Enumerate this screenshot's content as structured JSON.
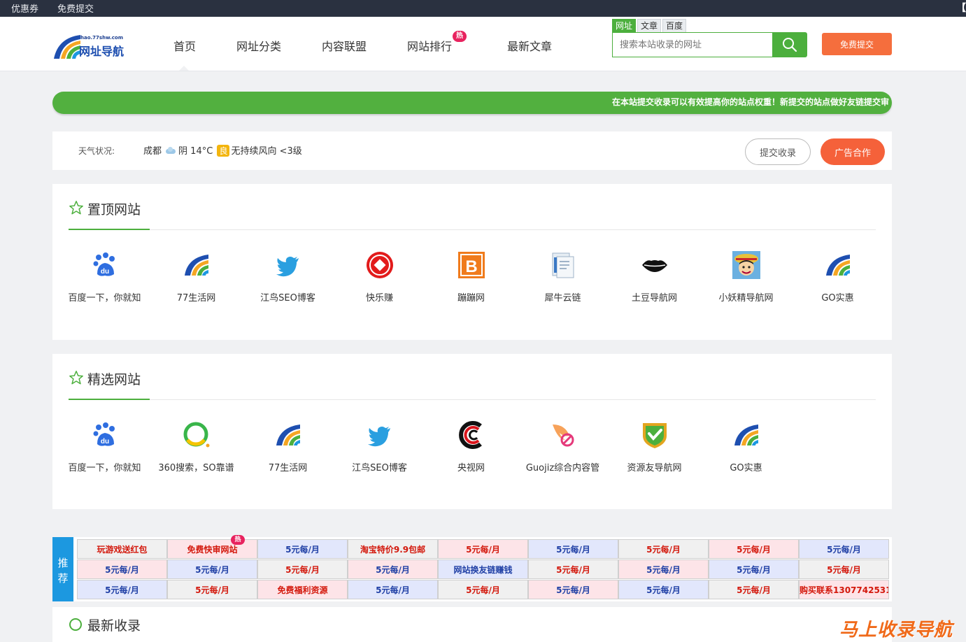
{
  "topbar": {
    "link1": "优惠券",
    "link2": "免费提交",
    "right_text": "【"
  },
  "logo": {
    "url": "hao.77shw.com",
    "name": "网址导航"
  },
  "nav": {
    "items": [
      "首页",
      "网址分类",
      "内容联盟",
      "网站排行",
      "最新文章"
    ],
    "active": "首页",
    "hot_badge": "热"
  },
  "search": {
    "tabs": [
      "网址",
      "文章",
      "百度"
    ],
    "active_tab": "网址",
    "placeholder": "搜索本站收录的网址",
    "submit_label": "免费提交"
  },
  "notice": {
    "text": "在本站提交收录可以有效提高你的站点权重！新提交的站点做好友链提交审"
  },
  "weather": {
    "label": "天气状况:",
    "city": "成都",
    "condition": "阴",
    "temp": "14°C",
    "aqi": "良",
    "wind": "无持续风向 <3级",
    "btn_submit": "提交收录",
    "btn_ad": "广告合作"
  },
  "pinned": {
    "title": "置顶网站",
    "sites": [
      {
        "name": "百度一下，你就知",
        "icon": "baidu-icon"
      },
      {
        "name": "77生活网",
        "icon": "77shw-logo-icon"
      },
      {
        "name": "江鸟SEO博客",
        "icon": "twitter-bird-icon"
      },
      {
        "name": "快乐赚",
        "icon": "red-coin-icon"
      },
      {
        "name": "蹦蹦网",
        "icon": "orange-b-icon"
      },
      {
        "name": "犀牛云链",
        "icon": "document-icon"
      },
      {
        "name": "土豆导航网",
        "icon": "lips-icon"
      },
      {
        "name": "小妖精导航网",
        "icon": "anime-avatar-icon"
      },
      {
        "name": "GO实惠",
        "icon": "77shw-logo-icon"
      }
    ]
  },
  "featured": {
    "title": "精选网站",
    "sites": [
      {
        "name": "百度一下，你就知",
        "icon": "baidu-icon"
      },
      {
        "name": "360搜索，SO靠谱",
        "icon": "360-ring-icon"
      },
      {
        "name": "77生活网",
        "icon": "77shw-logo-icon"
      },
      {
        "name": "江鸟SEO博客",
        "icon": "twitter-bird-icon"
      },
      {
        "name": "央视网",
        "icon": "cctv-icon"
      },
      {
        "name": "Guojiz综合内容管",
        "icon": "feather-icon"
      },
      {
        "name": "资源友导航网",
        "icon": "shield-check-icon"
      },
      {
        "name": "GO实惠",
        "icon": "77shw-logo-icon"
      }
    ]
  },
  "ads": {
    "side_label": [
      "推",
      "荐"
    ],
    "rows": [
      [
        {
          "text": "玩游戏送红包",
          "color": "red",
          "bg": "gray"
        },
        {
          "text": "免费快审网站",
          "color": "red",
          "bg": "pink"
        },
        {
          "text": "5元每/月",
          "color": "blue",
          "bg": "blue"
        },
        {
          "text": "淘宝特价9.9包邮",
          "color": "red",
          "bg": "gray"
        },
        {
          "text": "5元每/月",
          "color": "red",
          "bg": "pink"
        },
        {
          "text": "5元每/月",
          "color": "blue",
          "bg": "blue"
        },
        {
          "text": "5元每/月",
          "color": "red",
          "bg": "gray"
        },
        {
          "text": "5元每/月",
          "color": "red",
          "bg": "pink"
        },
        {
          "text": "5元每/月",
          "color": "blue",
          "bg": "blue"
        }
      ],
      [
        {
          "text": "5元每/月",
          "color": "blue",
          "bg": "pink"
        },
        {
          "text": "5元每/月",
          "color": "blue",
          "bg": "blue"
        },
        {
          "text": "5元每/月",
          "color": "red",
          "bg": "gray"
        },
        {
          "text": "5元每/月",
          "color": "blue",
          "bg": "pink"
        },
        {
          "text": "网站换友链赚钱",
          "color": "blue",
          "bg": "blue"
        },
        {
          "text": "5元每/月",
          "color": "red",
          "bg": "gray"
        },
        {
          "text": "5元每/月",
          "color": "blue",
          "bg": "pink"
        },
        {
          "text": "5元每/月",
          "color": "blue",
          "bg": "blue"
        },
        {
          "text": "5元每/月",
          "color": "red",
          "bg": "gray"
        }
      ],
      [
        {
          "text": "5元每/月",
          "color": "blue",
          "bg": "blue"
        },
        {
          "text": "5元每/月",
          "color": "red",
          "bg": "gray"
        },
        {
          "text": "免费福利资源",
          "color": "red",
          "bg": "pink"
        },
        {
          "text": "5元每/月",
          "color": "blue",
          "bg": "blue"
        },
        {
          "text": "5元每/月",
          "color": "red",
          "bg": "gray"
        },
        {
          "text": "5元每/月",
          "color": "blue",
          "bg": "pink"
        },
        {
          "text": "5元每/月",
          "color": "blue",
          "bg": "blue"
        },
        {
          "text": "5元每/月",
          "color": "red",
          "bg": "gray"
        },
        {
          "text": "购买联系1307742531",
          "color": "red",
          "bg": "pink"
        }
      ]
    ],
    "hot_badge": "热"
  },
  "latest": {
    "title": "最新收录"
  },
  "watermark": "马上收录导航",
  "colors": {
    "accent_green": "#4caf3d",
    "orange": "#f56e3d",
    "topbar": "#2a3140",
    "ad_blue": "#1c98e0"
  }
}
